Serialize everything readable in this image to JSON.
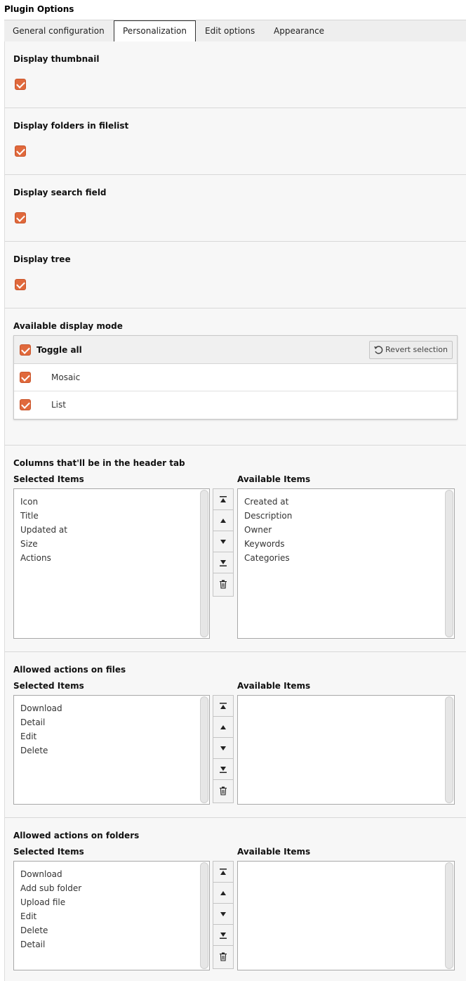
{
  "page_title": "Plugin Options",
  "tabs": [
    {
      "label": "General configuration",
      "active": false
    },
    {
      "label": "Personalization",
      "active": true
    },
    {
      "label": "Edit options",
      "active": false
    },
    {
      "label": "Appearance",
      "active": false
    }
  ],
  "options": {
    "display_thumbnail": {
      "label": "Display thumbnail",
      "checked": true
    },
    "display_folders": {
      "label": "Display folders in filelist",
      "checked": true
    },
    "display_search": {
      "label": "Display search field",
      "checked": true
    },
    "display_tree": {
      "label": "Display tree",
      "checked": true
    }
  },
  "display_mode": {
    "title": "Available display mode",
    "toggle_all": "Toggle all",
    "revert": "Revert selection",
    "items": [
      {
        "label": "Mosaic",
        "checked": true
      },
      {
        "label": "List",
        "checked": true
      }
    ]
  },
  "columns": {
    "title": "Columns that'll be in the header tab",
    "selected_label": "Selected Items",
    "available_label": "Available Items",
    "selected": [
      "Icon",
      "Title",
      "Updated at",
      "Size",
      "Actions"
    ],
    "available": [
      "Created at",
      "Description",
      "Owner",
      "Keywords",
      "Categories"
    ]
  },
  "file_actions": {
    "title": "Allowed actions on files",
    "selected_label": "Selected Items",
    "available_label": "Available Items",
    "selected": [
      "Download",
      "Detail",
      "Edit",
      "Delete"
    ],
    "available": []
  },
  "folder_actions": {
    "title": "Allowed actions on folders",
    "selected_label": "Selected Items",
    "available_label": "Available Items",
    "selected": [
      "Download",
      "Add sub folder",
      "Upload file",
      "Edit",
      "Delete",
      "Detail"
    ],
    "available": []
  },
  "colors": {
    "checkbox": "#e0693c",
    "active_tab_border": "#333333"
  }
}
